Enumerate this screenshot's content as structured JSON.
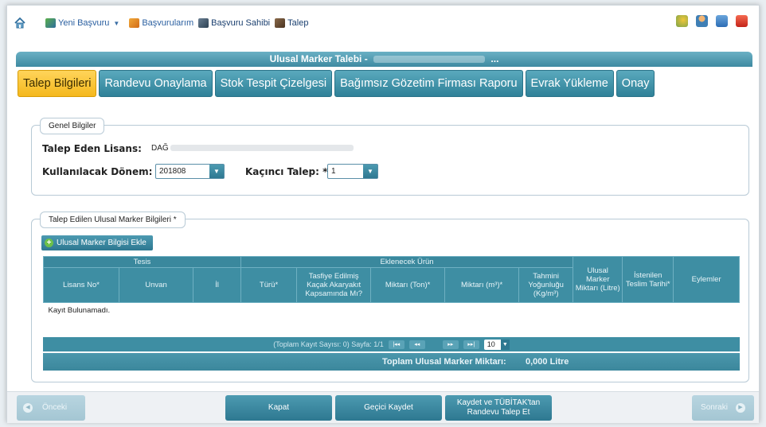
{
  "menu": {
    "items": [
      {
        "label": "Yeni Başvuru",
        "icon": "new-application-icon",
        "has_dropdown": true
      },
      {
        "label": "Başvurularım",
        "icon": "my-applications-icon",
        "has_dropdown": false
      },
      {
        "label": "Başvuru Sahibi",
        "icon": "applicant-icon",
        "has_dropdown": false
      },
      {
        "label": "Talep",
        "icon": "request-icon",
        "has_dropdown": false
      }
    ],
    "dropdown_glyph": "▼"
  },
  "window": {
    "title": "Ulusal Marker Talebi -",
    "title_suffix": "..."
  },
  "tabs": [
    {
      "label": "Talep Bilgileri",
      "active": true
    },
    {
      "label": "Randevu Onaylama",
      "active": false
    },
    {
      "label": "Stok Tespit Çizelgesi",
      "active": false
    },
    {
      "label": "Bağımsız Gözetim Firması Raporu",
      "active": false
    },
    {
      "label": "Evrak Yükleme",
      "active": false
    },
    {
      "label": "Onay",
      "active": false
    }
  ],
  "general": {
    "legend": "Genel Bilgiler",
    "license_label": "Talep Eden Lisans:",
    "license_value": "DAĞ",
    "period_label": "Kullanılacak Dönem: *",
    "period_value": "201808",
    "request_no_label": "Kaçıncı Talep: *",
    "request_no_value": "1"
  },
  "marker": {
    "legend": "Talep Edilen Ulusal Marker Bilgileri *",
    "add_button": "Ulusal Marker Bilgisi Ekle",
    "group_headers": {
      "tesis": "Tesis",
      "urun": "Eklenecek Ürün"
    },
    "columns": {
      "lisans_no": "Lisans No*",
      "unvan": "Unvan",
      "il": "İl",
      "turu": "Türü*",
      "tasfiye": "Tasfiye Edilmiş Kaçak Akaryakıt Kapsamında Mı?",
      "miktar_ton": "Miktarı (Ton)*",
      "miktar_m3": "Miktarı (m³)*",
      "yogunluk": "Tahmini Yoğunluğu (Kg/m³)",
      "marker_miktari": "Ulusal Marker Miktarı (Litre)",
      "teslim_tarihi": "İstenilen Teslim Tarihi*",
      "eylemler": "Eylemler"
    },
    "empty_text": "Kayıt Bulunamadı.",
    "pager": {
      "info": "(Toplam Kayıt Sayısı: 0) Sayfa: 1/1",
      "first": "|◂◂",
      "prev": "◂◂",
      "next": "▸▸",
      "last": "▸▸|",
      "page_size": "10",
      "page_size_arrow": "▼"
    },
    "total_label": "Toplam Ulusal Marker Miktarı:",
    "total_value": "0,000 Litre"
  },
  "footer": {
    "prev": "Önceki",
    "close": "Kapat",
    "temp_save": "Geçici Kaydet",
    "save_request_line1": "Kaydet ve TÜBİTAK'tan",
    "save_request_line2": "Randevu Talep Et",
    "next": "Sonraki",
    "prev_glyph": "◀",
    "next_glyph": "▶"
  },
  "colors": {
    "accent": "#3e8ea3",
    "active_tab": "#f4b81d",
    "disabled_button": "#a4c6d3"
  }
}
